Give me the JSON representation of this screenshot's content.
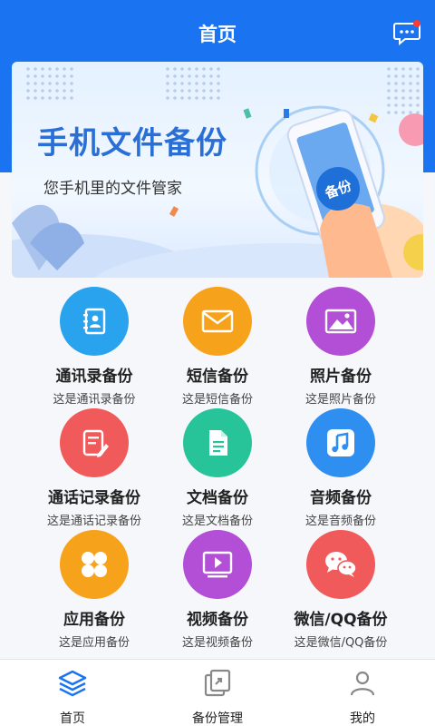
{
  "header": {
    "title": "首页"
  },
  "banner": {
    "title": "手机文件备份",
    "subtitle": "您手机里的文件管家",
    "phone_badge": "备份"
  },
  "features": [
    {
      "label": "通讯录备份",
      "desc": "这是通讯录备份",
      "icon": "contacts-icon",
      "color": "#2aa3ef"
    },
    {
      "label": "短信备份",
      "desc": "这是短信备份",
      "icon": "envelope-icon",
      "color": "#f7a21b"
    },
    {
      "label": "照片备份",
      "desc": "这是照片备份",
      "icon": "image-icon",
      "color": "#b24fd6"
    },
    {
      "label": "通话记录备份",
      "desc": "这是通话记录备份",
      "icon": "call-log-icon",
      "color": "#f15a5a"
    },
    {
      "label": "文档备份",
      "desc": "这是文档备份",
      "icon": "document-icon",
      "color": "#27c49a"
    },
    {
      "label": "音频备份",
      "desc": "这是音频备份",
      "icon": "music-icon",
      "color": "#2e8ff0"
    },
    {
      "label": "应用备份",
      "desc": "这是应用备份",
      "icon": "apps-icon",
      "color": "#f7a21b"
    },
    {
      "label": "视频备份",
      "desc": "这是视频备份",
      "icon": "video-icon",
      "color": "#b24fd6"
    },
    {
      "label": "微信/QQ备份",
      "desc": "这是微信/QQ备份",
      "icon": "wechat-icon",
      "color": "#f15a5a"
    }
  ],
  "tabbar": {
    "home": "首页",
    "backup_manage": "备份管理",
    "mine": "我的"
  }
}
